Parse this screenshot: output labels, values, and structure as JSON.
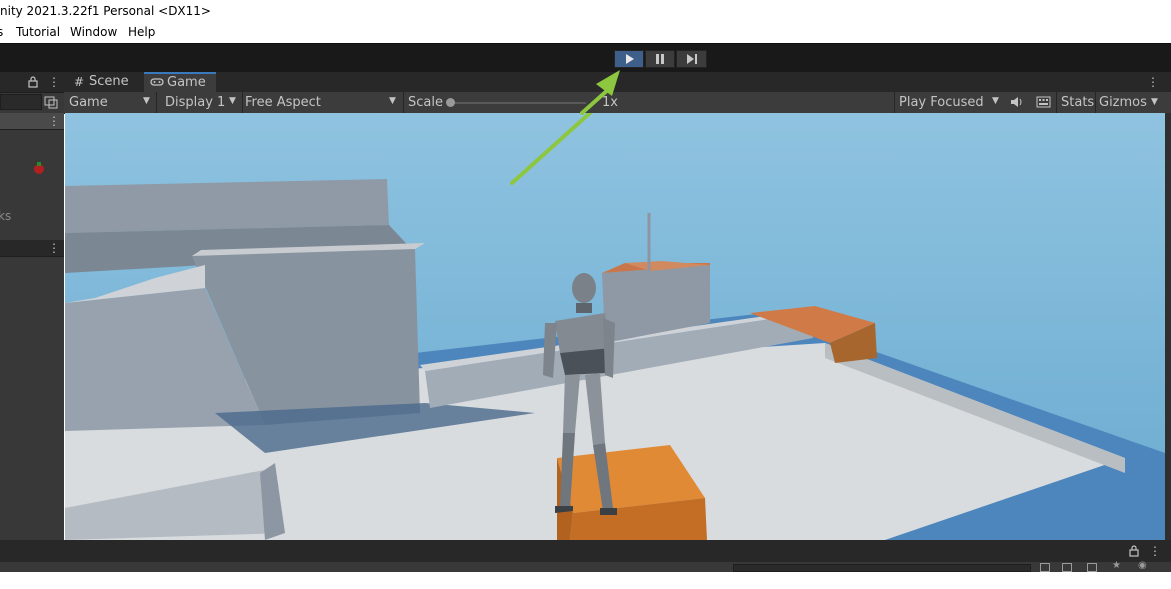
{
  "window": {
    "title": "nity 2021.3.22f1 Personal <DX11>"
  },
  "menu": {
    "items": [
      "s",
      "Tutorial",
      "Window",
      "Help"
    ]
  },
  "toolbar": {
    "play_icon": "play-icon",
    "pause_icon": "pause-icon",
    "step_icon": "step-icon"
  },
  "left_panel": {
    "partial_text": "ks"
  },
  "tabs": [
    {
      "label": "Scene",
      "icon": "hash-icon"
    },
    {
      "label": "Game",
      "icon": "gamepad-icon"
    }
  ],
  "game_toolbar": {
    "mode": "Game",
    "display": "Display 1",
    "aspect": "Free Aspect",
    "scale_label": "Scale",
    "scale_value": "1x",
    "play_mode": "Play Focused",
    "stats": "Stats",
    "gizmos": "Gizmos"
  },
  "colors": {
    "accent": "#3a79bb",
    "arrow": "#8dc63f",
    "sky": "#78b6d8",
    "orange": "#d07a2e"
  }
}
